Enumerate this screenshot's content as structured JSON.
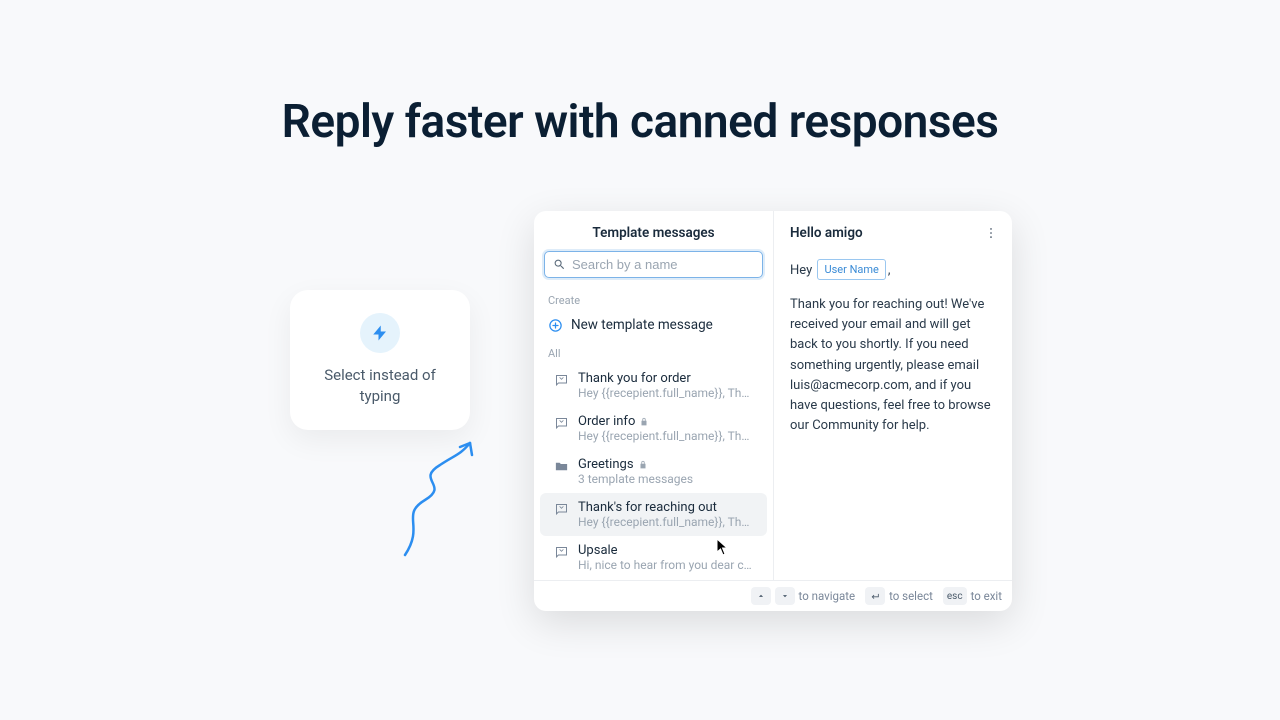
{
  "headline": "Reply faster with canned responses",
  "callout": {
    "text": "Select instead of typing"
  },
  "panel": {
    "left_title": "Template messages",
    "search_placeholder": "Search by a name",
    "section_create": "Create",
    "create_action": "New template message",
    "section_all": "All",
    "items": [
      {
        "title": "Thank you for order",
        "sub": "Hey {{recepient.full_name}}, Thank you for yo...",
        "locked": false,
        "folder": false
      },
      {
        "title": "Order info",
        "sub": "Hey {{recepient.full_name}}, Thank you for yo...",
        "locked": true,
        "folder": false
      },
      {
        "title": "Greetings",
        "sub": "3 template messages",
        "locked": true,
        "folder": true
      },
      {
        "title": "Thank's for reaching out",
        "sub": "Hey {{recepient.full_name}}, Thank you for yo...",
        "locked": false,
        "folder": false,
        "selected": true
      },
      {
        "title": "Upsale",
        "sub": "Hi, nice to hear from you dear customer, how...",
        "locked": false,
        "folder": false
      }
    ]
  },
  "preview": {
    "title": "Hello amigo",
    "greeting_prefix": "Hey",
    "variable": "User Name",
    "greeting_suffix": ",",
    "body": "Thank you for reaching out! We've received your email and will get back to you shortly. If you need something urgently, please email luis@acmecorp.com, and if you have questions, feel free to browse our Community for help."
  },
  "footer": {
    "navigate": "to navigate",
    "select": "to select",
    "exit": "to exit",
    "esc": "esc"
  }
}
